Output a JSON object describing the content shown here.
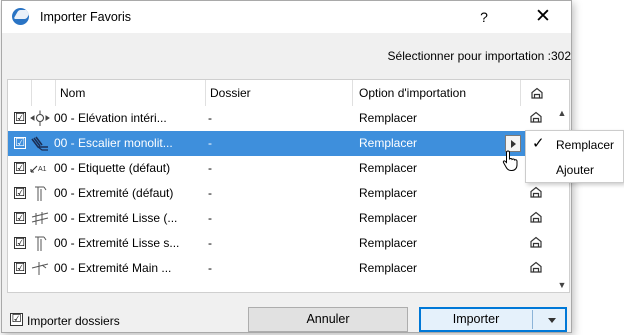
{
  "window": {
    "title": "Importer Favoris",
    "help_label": "?",
    "close_label": "✕"
  },
  "selection_count": "Sélectionner pour importation :302",
  "columns": {
    "name": "Nom",
    "folder": "Dossier",
    "option": "Option d'importation"
  },
  "rows": [
    {
      "checked": "☑",
      "name": "00 - Elévation intéri...",
      "folder": "-",
      "option": "Remplacer",
      "icon": "elevation-icon",
      "selected": false
    },
    {
      "checked": "☑",
      "name": "00 - Escalier monolit...",
      "folder": "-",
      "option": "Remplacer",
      "icon": "stair-icon",
      "selected": true
    },
    {
      "checked": "☑",
      "name": "00 - Etiquette (défaut)",
      "folder": "-",
      "option": "Remplacer",
      "icon": "label-icon",
      "selected": false
    },
    {
      "checked": "☑",
      "name": "00 - Extremité (défaut)",
      "folder": "-",
      "option": "Remplacer",
      "icon": "railing-end-icon",
      "selected": false
    },
    {
      "checked": "☑",
      "name": "00 - Extremité Lisse (...",
      "folder": "-",
      "option": "Remplacer",
      "icon": "rail-icon",
      "selected": false
    },
    {
      "checked": "☑",
      "name": "00 - Extremité Lisse s...",
      "folder": "-",
      "option": "Remplacer",
      "icon": "railing-end-icon",
      "selected": false
    },
    {
      "checked": "☑",
      "name": "00 - Extremité Main ...",
      "folder": "-",
      "option": "Remplacer",
      "icon": "handrail-icon",
      "selected": false
    }
  ],
  "popup": {
    "items": [
      {
        "label": "Remplacer",
        "checked": true
      },
      {
        "label": "Ajouter",
        "checked": false
      }
    ],
    "check_glyph": "✓"
  },
  "footer": {
    "import_folders_label": "Importer dossiers",
    "import_folders_checked": "☑",
    "cancel_label": "Annuler",
    "import_label": "Importer"
  },
  "colors": {
    "selection": "#3e8fdc",
    "accent": "#0078d7"
  }
}
